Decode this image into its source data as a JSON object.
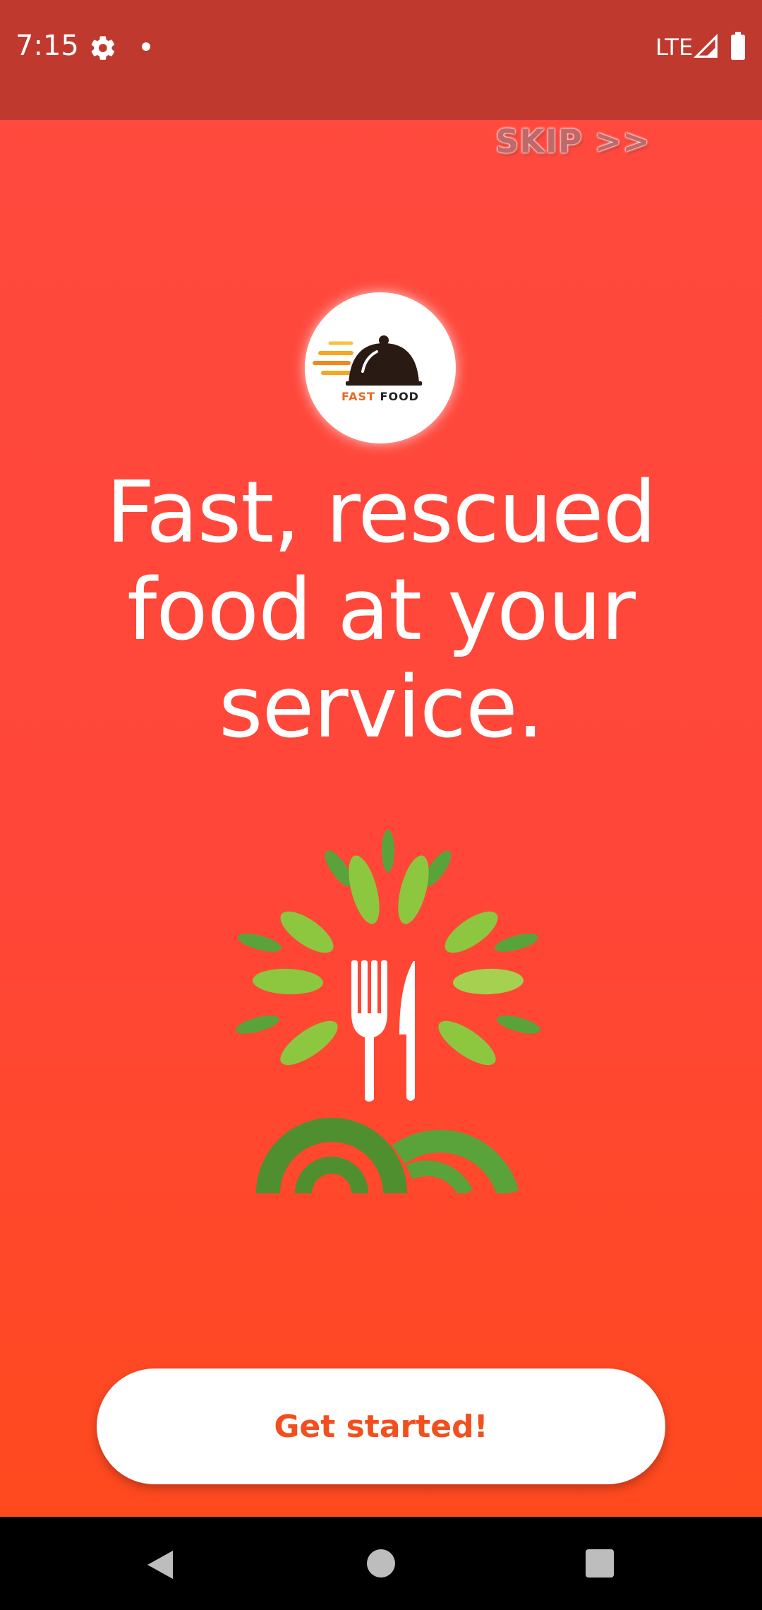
{
  "status_bar": {
    "time": "7:15",
    "network": "LTE",
    "icons": [
      "gear-icon",
      "notification-dot-icon",
      "signal-icon",
      "battery-icon"
    ]
  },
  "onboarding": {
    "skip_label": "SKIP >>",
    "logo": {
      "word_fast": "FAST",
      "word_food": "FOOD"
    },
    "headline_lines": [
      "Fast, rescued",
      "food at your",
      "service."
    ],
    "illustration": "fork-knife-leaves-icon",
    "cta_label": "Get started!"
  },
  "nav_bar": {
    "icons": [
      "back-icon",
      "home-icon",
      "recents-icon"
    ]
  },
  "colors": {
    "status_bar": "#c0392f",
    "background_top": "#ff4a3f",
    "background_bottom": "#ff4a1a",
    "cta_text": "#f1501e",
    "leaf_light": "#8dc63f",
    "leaf_dark": "#4f8f2f"
  }
}
